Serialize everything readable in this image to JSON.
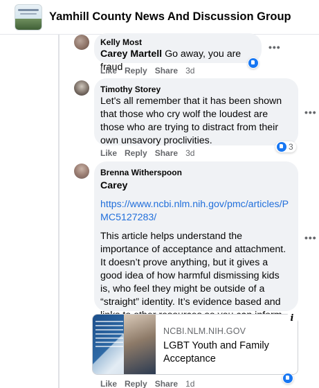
{
  "group": {
    "name": "Yamhill County News And Discussion Group"
  },
  "comments": [
    {
      "author": "Kelly Most",
      "mention": "Carey Martell",
      "text": "Go away, you are fraud",
      "actions": [
        "Like",
        "Reply",
        "Share"
      ],
      "time": "3d",
      "reaction_count": ""
    },
    {
      "author": "Timothy Storey",
      "text": "Let's all remember that it has been shown that those who cry wolf the loudest are those who are trying to distract from their own unsavory proclivities.",
      "actions": [
        "Like",
        "Reply",
        "Share"
      ],
      "time": "3d",
      "reaction_count": "3"
    },
    {
      "author": "Brenna Witherspoon",
      "mention": "Carey",
      "link": "https://www.ncbi.nlm.nih.gov/pmc/articles/PMC5127283/",
      "text": "This article helps understand the importance of acceptance and attachment. It doesn’t prove anything, but it gives a good idea of how harmful dismissing kids is, who feel they might be outside of a “straight” identity. It’s evidence based and links to other resources so you can inform yourself.",
      "link_preview": {
        "domain": "NCBI.NLM.NIH.GOV",
        "title": "LGBT Youth and Family Acceptance"
      },
      "actions": [
        "Like",
        "Reply",
        "Share"
      ],
      "time": "1d",
      "reaction_count": ""
    }
  ],
  "icons": {
    "more": "more-options-icon",
    "info": "info-icon",
    "like": "like-reaction-icon"
  },
  "colors": {
    "bubble": "#f0f2f5",
    "link": "#216fdb",
    "like": "#1877f2",
    "meta": "#65676b"
  }
}
